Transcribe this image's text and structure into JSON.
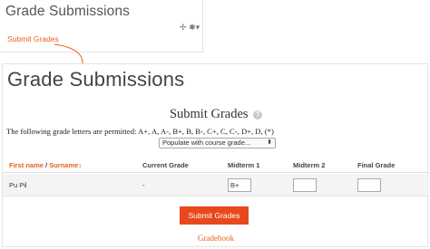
{
  "block": {
    "title": "Grade Submissions",
    "move_icon": "✢",
    "gear_icon": "✱▾",
    "link": "Submit Grades"
  },
  "page": {
    "title": "Grade Submissions",
    "heading": "Submit Grades",
    "help_icon": "?",
    "permitted_text": "The following grade letters are permitted: A+, A, A-, B+, B, B-, C+, C, C-, D+, D, (*)",
    "populate_select": "Populate with course grade...",
    "populate_caret": "⬍"
  },
  "table": {
    "headers": {
      "first_name": "First name",
      "separator": " / ",
      "surname": "Surname",
      "sort_icon": "↕",
      "current_grade": "Current Grade",
      "midterm1": "Midterm 1",
      "midterm2": "Midterm 2",
      "final_grade": "Final Grade"
    },
    "rows": [
      {
        "name": "Pu Pil",
        "current_grade": "-",
        "midterm1": "B+",
        "midterm2": "",
        "final_grade": ""
      }
    ]
  },
  "actions": {
    "submit_label": "Submit Grades",
    "gradebook_label": "Gradebook"
  },
  "colors": {
    "accent": "#e8611a",
    "button": "#e8481c"
  }
}
